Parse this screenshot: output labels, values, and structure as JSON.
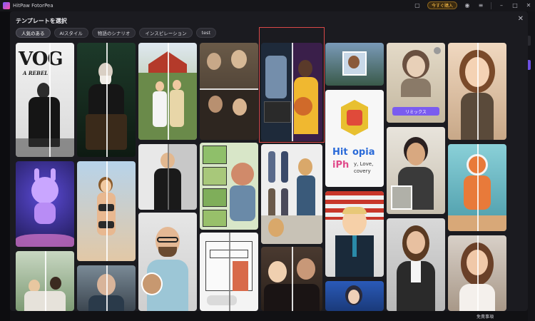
{
  "app": {
    "name": "HitPaw FotorPea",
    "buy_label": "今すぐ購入"
  },
  "modal": {
    "title": "テンプレートを選択",
    "tabs": [
      {
        "label": "人気のある",
        "active": true
      },
      {
        "label": "AIスタイル",
        "active": false
      },
      {
        "label": "物語のシナリオ",
        "active": false
      },
      {
        "label": "インスピレーション",
        "active": false
      },
      {
        "label": "test",
        "active": false
      }
    ]
  },
  "cards": {
    "vogue_title": "VOG",
    "vogue_subtitle": "A REBEL",
    "hitopia_title_left": "Hit",
    "hitopia_title_right": "opia",
    "hitopia_line1": "iPh",
    "hitopia_line2": "y, Love,",
    "hitopia_line3": "covery",
    "remix_label": "リミックス"
  },
  "status_bar": {
    "label": "免責事項"
  },
  "colors": {
    "accent": "#7a5cf0",
    "selection": "#d94848",
    "buy": "#ffc14a"
  }
}
